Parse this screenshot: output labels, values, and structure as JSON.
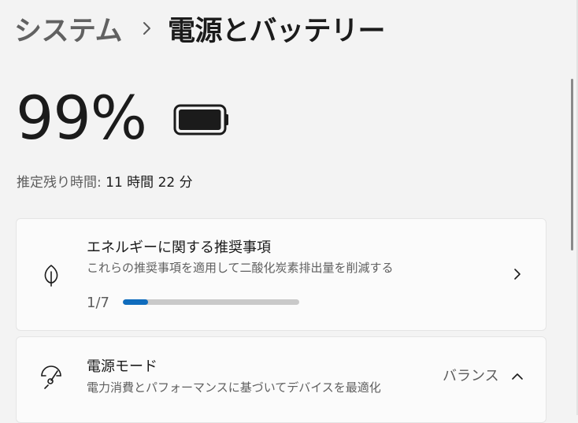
{
  "breadcrumb": {
    "parent": "システム",
    "current": "電源とバッテリー"
  },
  "battery": {
    "percent_label": "99%",
    "level": 0.99,
    "estimate_label": "推定残り時間:",
    "estimate_value": "11 時間 22 分"
  },
  "energy_recommendations": {
    "title": "エネルギーに関する推奨事項",
    "description": "これらの推奨事項を適用して二酸化炭素排出量を削減する",
    "progress_label": "1/7",
    "progress_fraction": 0.142857,
    "icon": "leaf-icon"
  },
  "power_mode": {
    "title": "電源モード",
    "description": "電力消費とパフォーマンスに基づいてデバイスを最適化",
    "value": "バランス",
    "icon": "gauge-icon"
  },
  "colors": {
    "accent": "#0f6cbd",
    "background": "#f3f3f3",
    "card": "#fbfbfb"
  }
}
